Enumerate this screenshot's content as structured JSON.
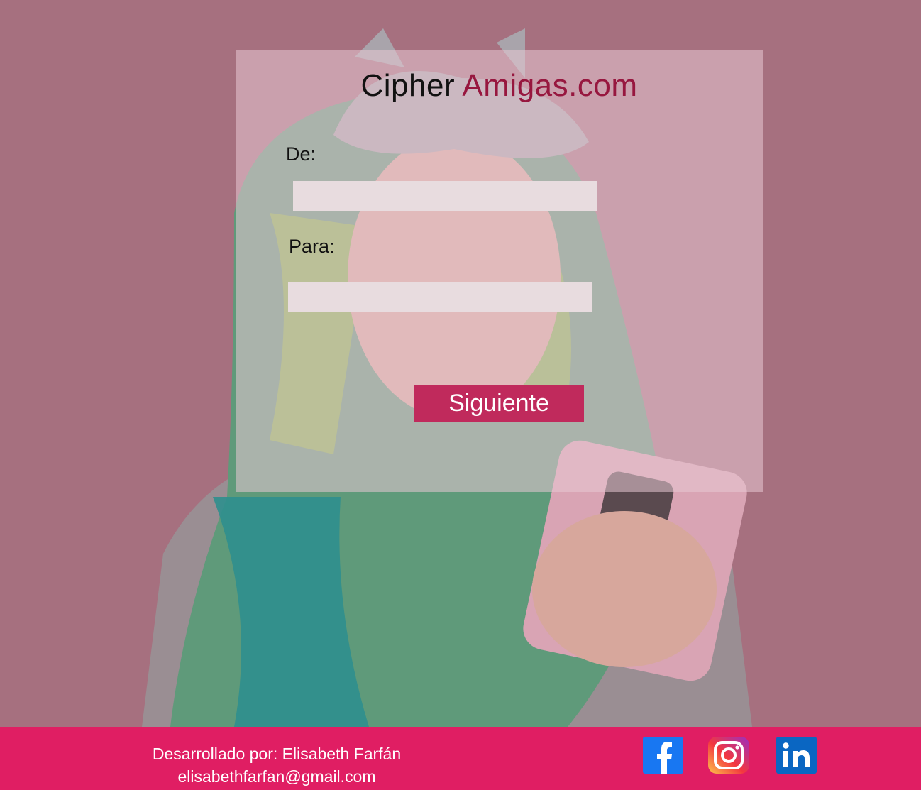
{
  "app": {
    "title_main": "Cipher ",
    "title_accent": "Amigas.com"
  },
  "form": {
    "from_label": "De:",
    "from_value": "",
    "to_label": "Para:",
    "to_value": "",
    "next_button": "Siguiente"
  },
  "footer": {
    "credit_line": "Desarrollado por: Elisabeth Farfán",
    "email": "elisabethfarfan@gmail.com",
    "social": [
      {
        "name": "facebook",
        "icon": "facebook-icon",
        "glyph": "f"
      },
      {
        "name": "instagram",
        "icon": "instagram-icon"
      },
      {
        "name": "linkedin",
        "icon": "linkedin-icon",
        "glyph": "in"
      }
    ]
  },
  "colors": {
    "background": "#a6707f",
    "accent": "#97173f",
    "button": "#c02a5c",
    "footer": "#e01e63",
    "facebook": "#1877f2",
    "linkedin": "#0a66c2"
  }
}
